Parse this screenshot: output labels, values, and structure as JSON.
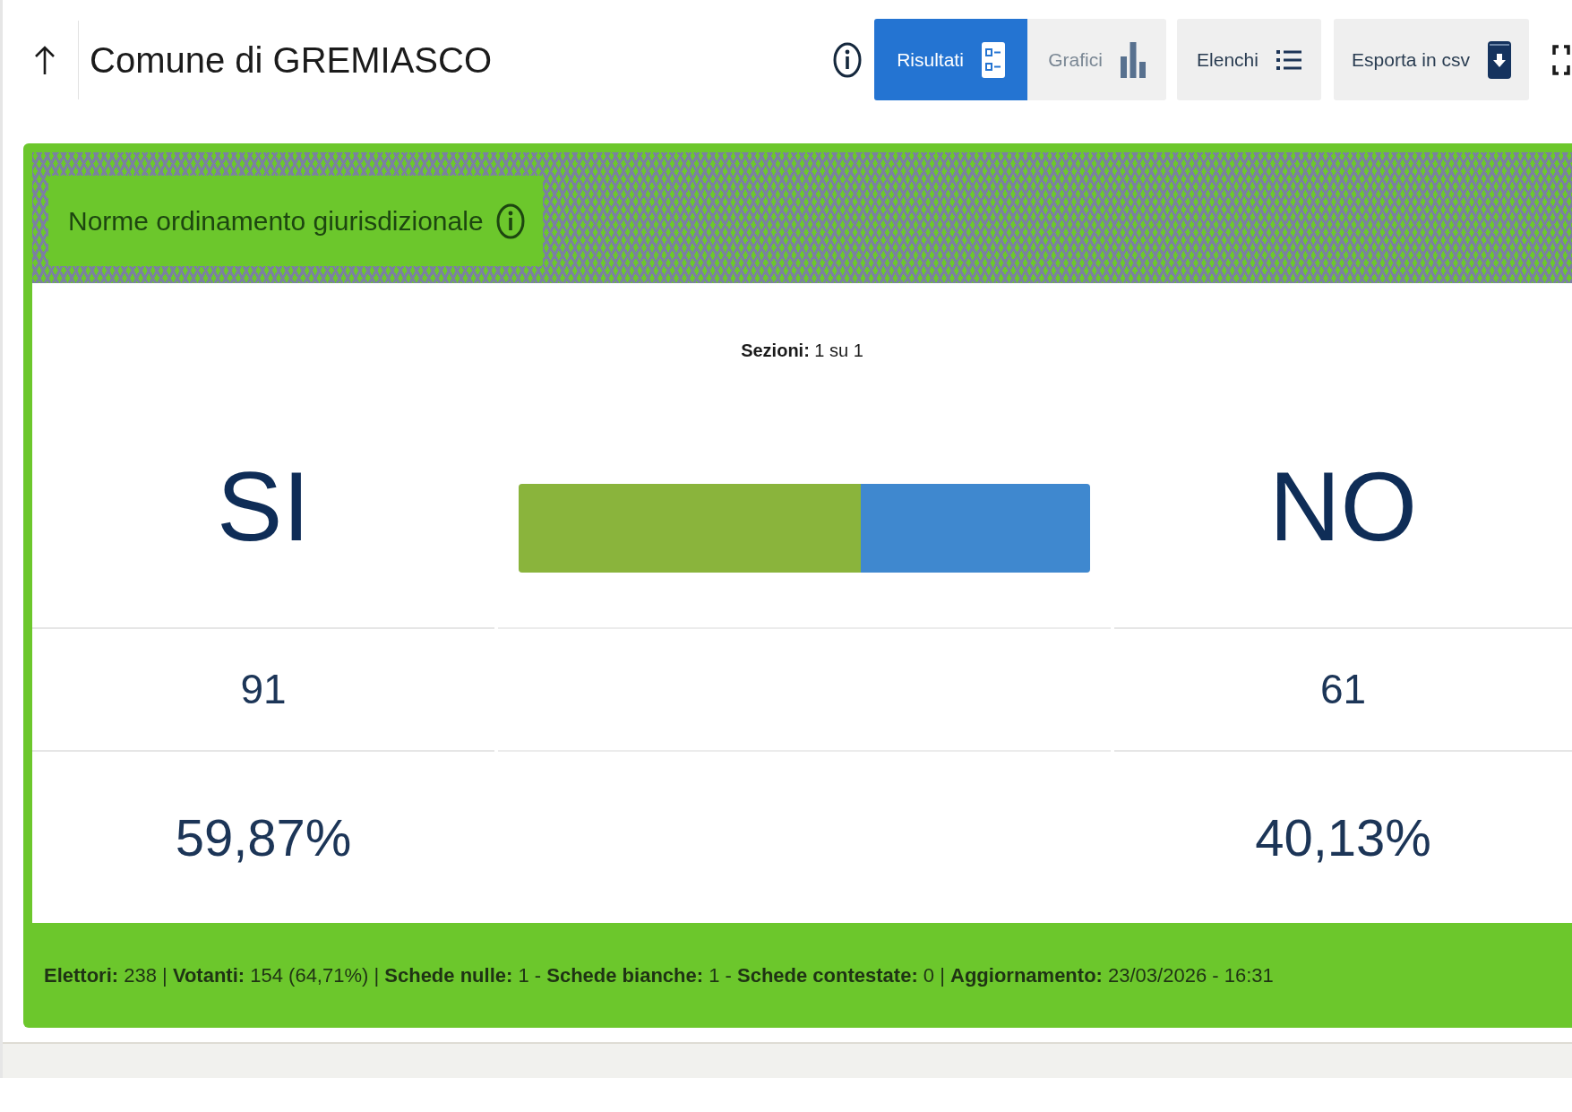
{
  "header": {
    "title": "Comune di GREMIASCO"
  },
  "toolbar": {
    "view_tabs": [
      {
        "label": "Risultati",
        "kind": "results",
        "selected": true
      },
      {
        "label": "Grafici",
        "kind": "charts",
        "selected": false
      }
    ],
    "buttons": [
      {
        "label": "Elenchi",
        "kind": "list"
      },
      {
        "label": "Esporta in csv",
        "kind": "export"
      }
    ]
  },
  "card": {
    "title": "Norme ordinamento giurisdizionale",
    "sections": "**Sezioni:** 1 su 1",
    "options": [
      {
        "name": "SI",
        "votes": "91",
        "percent": "59,87%",
        "level": 0.5987,
        "color": "#8ab43c"
      },
      {
        "name": "NO",
        "votes": "61",
        "percent": "40,13%",
        "level": 0.4013,
        "color": "#3f88cf"
      }
    ],
    "summary": "**Elettori:** 238 | **Votanti:** 154 (64,71%) | **Schede nulle:** 1 - **Schede bianche:** 1 - **Schede contestate:** 0 | **Aggiornamento:** 23/03/2026 - 16:31"
  }
}
